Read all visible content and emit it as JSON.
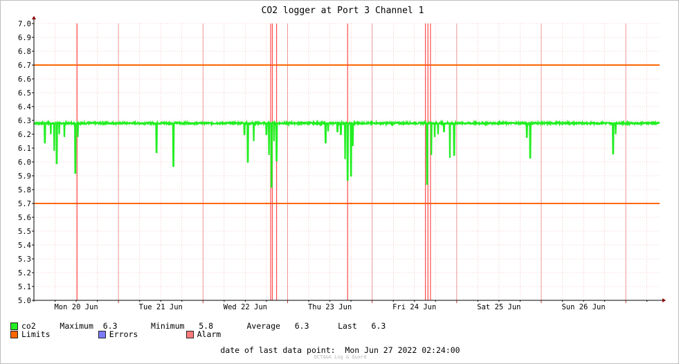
{
  "chart_data": {
    "type": "line",
    "title": "CO2 logger at Port 3 Channel 1",
    "ylim": [
      5.0,
      7.0
    ],
    "yticks": [
      "5.0",
      "5.1",
      "5.2",
      "5.3",
      "5.4",
      "5.5",
      "5.6",
      "5.7",
      "5.8",
      "5.9",
      "6.0",
      "6.1",
      "6.2",
      "6.3",
      "6.4",
      "6.5",
      "6.6",
      "6.7",
      "6.8",
      "6.9",
      "7.0"
    ],
    "xlim": [
      0.0,
      7.4
    ],
    "xticks": [
      {
        "x": 0.5,
        "label": "Mon 20 Jun"
      },
      {
        "x": 1.5,
        "label": "Tue 21 Jun"
      },
      {
        "x": 2.5,
        "label": "Wed 22 Jun"
      },
      {
        "x": 3.5,
        "label": "Thu 23 Jun"
      },
      {
        "x": 4.5,
        "label": "Fri 24 Jun"
      },
      {
        "x": 5.5,
        "label": "Sat 25 Jun"
      },
      {
        "x": 6.5,
        "label": "Sun 26 Jun"
      }
    ],
    "grid": true,
    "baseline": 6.28,
    "series": [
      {
        "name": "co2",
        "color": "#22ee22",
        "dips": [
          [
            0.13,
            6.14
          ],
          [
            0.2,
            6.2
          ],
          [
            0.24,
            6.08
          ],
          [
            0.27,
            5.99
          ],
          [
            0.3,
            6.2
          ],
          [
            0.36,
            6.18
          ],
          [
            0.49,
            5.92
          ],
          [
            0.52,
            6.18
          ],
          [
            1.45,
            6.07
          ],
          [
            1.65,
            5.97
          ],
          [
            2.49,
            6.2
          ],
          [
            2.53,
            6.0
          ],
          [
            2.6,
            6.15
          ],
          [
            2.75,
            6.2
          ],
          [
            2.78,
            6.05
          ],
          [
            2.81,
            5.82
          ],
          [
            2.84,
            6.15
          ],
          [
            2.87,
            6.01
          ],
          [
            3.45,
            6.14
          ],
          [
            3.48,
            6.22
          ],
          [
            3.59,
            6.22
          ],
          [
            3.63,
            6.2
          ],
          [
            3.68,
            6.02
          ],
          [
            3.71,
            5.87
          ],
          [
            3.75,
            5.9
          ],
          [
            3.77,
            6.12
          ],
          [
            4.65,
            5.84
          ],
          [
            4.7,
            6.05
          ],
          [
            4.74,
            6.18
          ],
          [
            4.78,
            6.2
          ],
          [
            4.85,
            6.22
          ],
          [
            4.92,
            6.03
          ],
          [
            4.97,
            6.05
          ],
          [
            5.83,
            6.18
          ],
          [
            5.87,
            6.03
          ],
          [
            6.85,
            6.06
          ],
          [
            6.88,
            6.2
          ]
        ]
      },
      {
        "name": "Limits",
        "color": "#ff6600",
        "values": [
          6.7,
          5.7
        ]
      }
    ],
    "alarms": [
      0.51,
      2.8,
      2.82,
      2.87,
      3.71,
      4.63,
      4.66,
      4.69
    ]
  },
  "legend": {
    "row1": {
      "series": "co2",
      "max_label": "Maximum",
      "max": "6.3",
      "min_label": "Minimum",
      "min": "5.8",
      "avg_label": "Average",
      "avg": "6.3",
      "last_label": "Last",
      "last": "6.3"
    },
    "row2": {
      "limits": "Limits",
      "errors": "Errors",
      "alarm": "Alarm"
    },
    "colors": {
      "co2": "#22ee22",
      "limits": "#ff6600",
      "errors": "#7b7bff",
      "alarm": "#ff7b7b"
    }
  },
  "footer": {
    "label": "date of last data point:",
    "value": "Mon Jun 27 2022 02:24:00"
  },
  "credit": "OCTA&A Log & Guard"
}
